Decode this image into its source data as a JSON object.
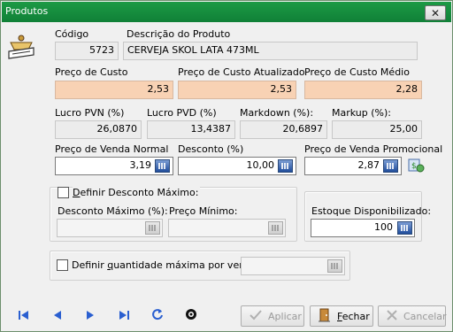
{
  "window": {
    "title": "Produtos"
  },
  "icons": {
    "app": "scale-icon",
    "close": "close-icon"
  },
  "product": {
    "codigo_label": "Código",
    "codigo_value": "5723",
    "descricao_label": "Descrição do Produto",
    "descricao_value": "CERVEJA SKOL LATA 473ML"
  },
  "custo": {
    "preco_label": "Preço de Custo",
    "preco_value": "2,53",
    "atualizado_label": "Preço de Custo Atualizado",
    "atualizado_value": "2,53",
    "medio_label": "Preço de Custo Médio",
    "medio_value": "2,28"
  },
  "margens": {
    "lucro_pvn_label": "Lucro PVN (%)",
    "lucro_pvn_value": "26,0870",
    "lucro_pvd_label": "Lucro PVD (%)",
    "lucro_pvd_value": "13,4387",
    "markdown_label": "Markdown (%):",
    "markdown_value": "20,6897",
    "markup_label": "Markup (%):",
    "markup_value": "25,00"
  },
  "venda": {
    "normal_label": "Preço de Venda Normal",
    "normal_value": "3,19",
    "desconto_label": "Desconto (%)",
    "desconto_value": "10,00",
    "promocional_label": "Preço de Venda Promocional",
    "promocional_value": "2,87"
  },
  "desconto_max": {
    "checkbox_label_prefix": "D",
    "checkbox_label_rest": "efinir Desconto Máximo:",
    "desconto_maximo_label": "Desconto Máximo (%):",
    "desconto_maximo_value": "",
    "preco_minimo_label": "Preço Mínimo:",
    "preco_minimo_value": ""
  },
  "estoque": {
    "label": "Estoque Disponibilizado:",
    "value": "100"
  },
  "quantidade": {
    "checkbox_label_before": "Definir ",
    "checkbox_label_u": "q",
    "checkbox_label_after": "uantidade máxima por venda:",
    "value": ""
  },
  "footer": {
    "aplicar_label": "Aplicar",
    "fechar_label_u": "F",
    "fechar_label_rest": "echar",
    "cancelar_label": "Cancelar"
  }
}
